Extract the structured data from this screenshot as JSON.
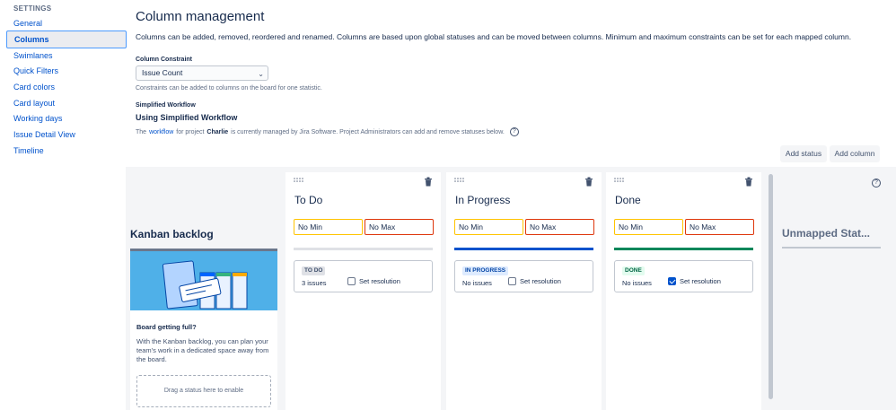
{
  "sidebar": {
    "heading": "SETTINGS",
    "items": [
      {
        "label": "General"
      },
      {
        "label": "Columns",
        "active": true
      },
      {
        "label": "Swimlanes"
      },
      {
        "label": "Quick Filters"
      },
      {
        "label": "Card colors"
      },
      {
        "label": "Card layout"
      },
      {
        "label": "Working days"
      },
      {
        "label": "Issue Detail View"
      },
      {
        "label": "Timeline"
      }
    ]
  },
  "header": {
    "title": "Column management",
    "description": "Columns can be added, removed, reordered and renamed. Columns are based upon global statuses and can be moved between columns. Minimum and maximum constraints can be set for each mapped column."
  },
  "constraint": {
    "label": "Column Constraint",
    "selected": "Issue Count",
    "help": "Constraints can be added to columns on the board for one statistic."
  },
  "workflow": {
    "label": "Simplified Workflow",
    "title": "Using Simplified Workflow",
    "text_prefix": "The",
    "link": "workflow",
    "text_mid": "for project",
    "project": "Charlie",
    "text_suffix": "is currently managed by Jira Software. Project Administrators can add and remove statuses below.",
    "help_icon": "question-circle-icon"
  },
  "actions": {
    "add_status": "Add status",
    "add_column": "Add column"
  },
  "backlog": {
    "title": "Kanban backlog",
    "heading": "Board getting full?",
    "body": "With the Kanban backlog, you can plan your team's work in a dedicated space away from the board.",
    "drop_hint": "Drag a status here to enable"
  },
  "columns": [
    {
      "title": "To Do",
      "min": "No Min",
      "max": "No Max",
      "status": "TO DO",
      "issues": "3 issues",
      "resolution_label": "Set resolution",
      "resolution": false,
      "bar_color": "#dfe1e6",
      "lozenge_bg": "#dfe1e6",
      "lozenge_fg": "#42526e"
    },
    {
      "title": "In Progress",
      "min": "No Min",
      "max": "No Max",
      "status": "IN PROGRESS",
      "issues": "No issues",
      "resolution_label": "Set resolution",
      "resolution": false,
      "bar_color": "#0052cc",
      "lozenge_bg": "#deebff",
      "lozenge_fg": "#0747a6"
    },
    {
      "title": "Done",
      "min": "No Min",
      "max": "No Max",
      "status": "DONE",
      "issues": "No issues",
      "resolution_label": "Set resolution",
      "resolution": true,
      "bar_color": "#00875a",
      "lozenge_bg": "#e3fcef",
      "lozenge_fg": "#006644"
    }
  ],
  "unmapped": {
    "title": "Unmapped Stat...",
    "help_icon": "question-circle-icon"
  }
}
